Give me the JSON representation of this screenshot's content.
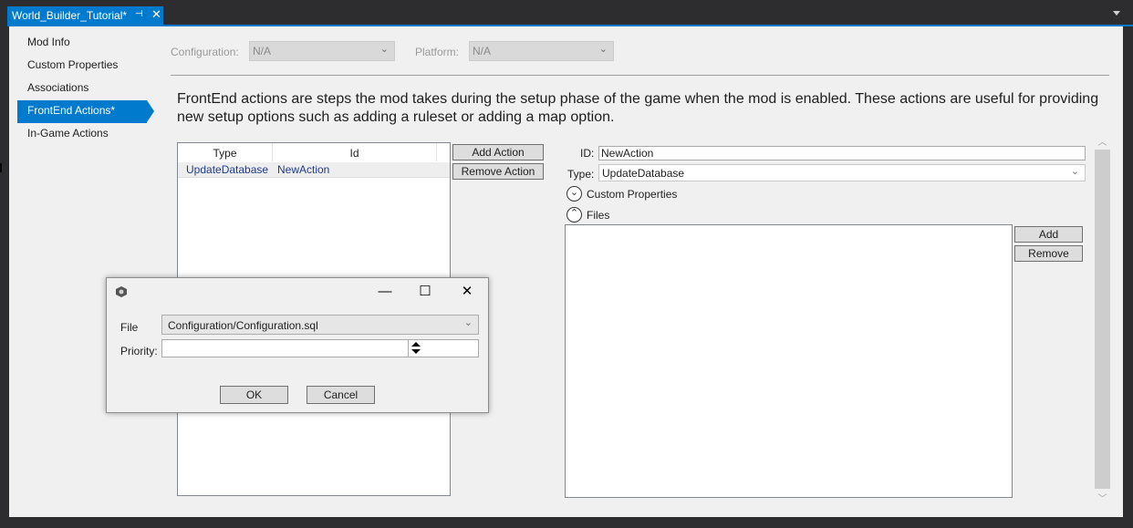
{
  "tab": {
    "title": "World_Builder_Tutorial*",
    "pin_icon": "⊣",
    "close_icon": "✕"
  },
  "sidebar": {
    "items": [
      {
        "label": "Mod Info",
        "selected": false
      },
      {
        "label": "Custom Properties",
        "selected": false
      },
      {
        "label": "Associations",
        "selected": false
      },
      {
        "label": "FrontEnd Actions*",
        "selected": true
      },
      {
        "label": "In-Game Actions",
        "selected": false
      }
    ]
  },
  "config": {
    "configuration_label": "Configuration:",
    "configuration_value": "N/A",
    "platform_label": "Platform:",
    "platform_value": "N/A"
  },
  "description": "FrontEnd actions are steps the mod takes during the setup phase of the game when the mod is enabled.  These actions are useful for providing new setup options such as adding a ruleset or adding a map option.",
  "actions": {
    "columns": [
      "Type",
      "Id"
    ],
    "rows": [
      {
        "type": "UpdateDatabase",
        "id": "NewAction"
      }
    ],
    "add_button": "Add Action",
    "remove_button": "Remove Action"
  },
  "details": {
    "id_label": "ID:",
    "id_value": "NewAction",
    "type_label": "Type:",
    "type_value": "UpdateDatabase",
    "custom_properties_label": "Custom Properties",
    "files_label": "Files",
    "add_button": "Add",
    "remove_button": "Remove"
  },
  "dialog": {
    "file_label": "File",
    "file_value": "Configuration/Configuration.sql",
    "priority_label": "Priority:",
    "priority_value": "",
    "ok_button": "OK",
    "cancel_button": "Cancel",
    "minimize_icon": "—",
    "maximize_icon": "☐",
    "close_icon": "✕"
  },
  "colors": {
    "accent": "#007acc",
    "chrome": "#2d2d30",
    "panel": "#f0f0f0",
    "link_text": "#1f3a8a"
  }
}
